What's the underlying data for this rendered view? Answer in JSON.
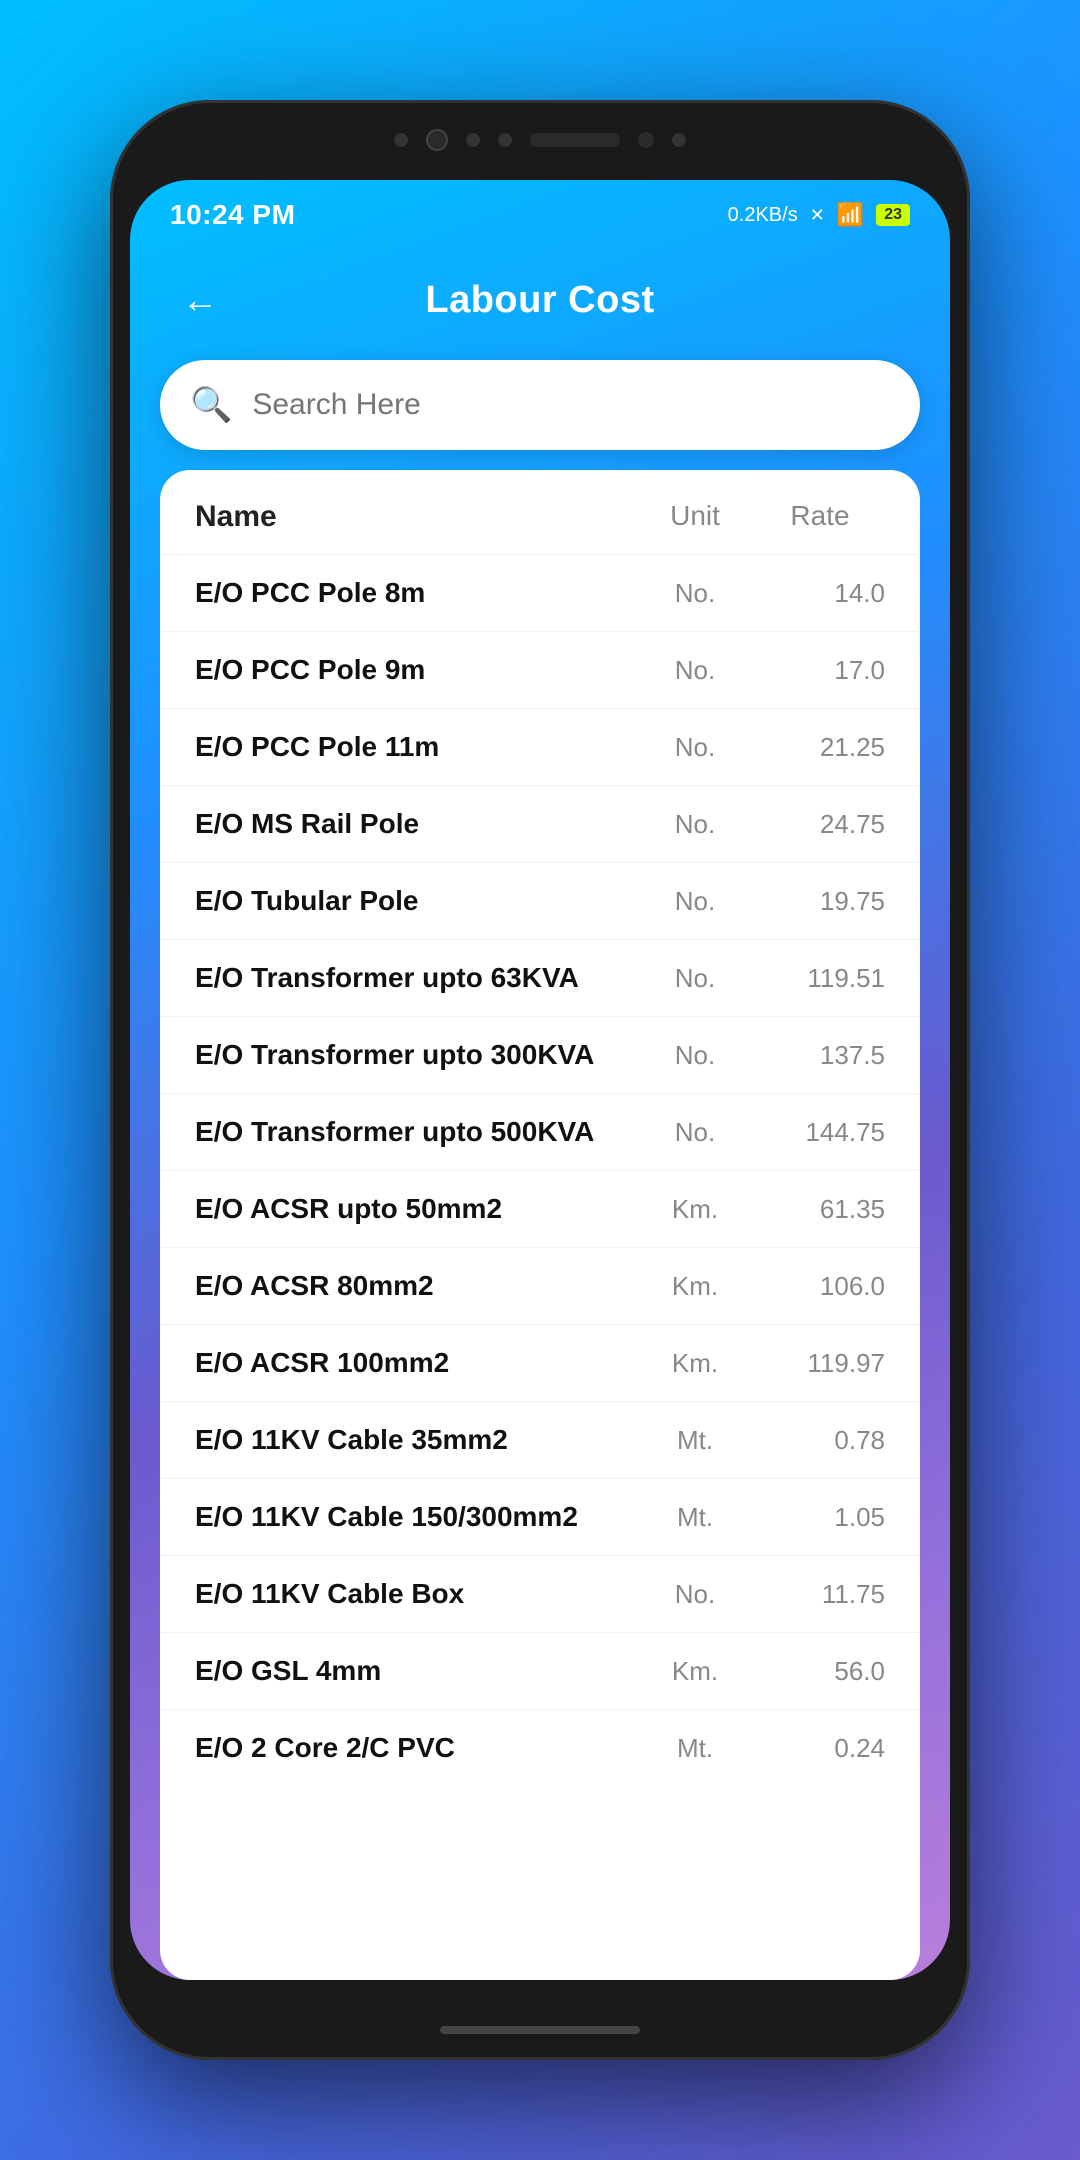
{
  "status": {
    "time": "10:24 PM",
    "speed": "0.2KB/s",
    "battery": "23"
  },
  "header": {
    "back_label": "←",
    "title": "Labour Cost"
  },
  "search": {
    "placeholder": "Search Here",
    "icon": "🔍"
  },
  "table": {
    "columns": {
      "name": "Name",
      "unit": "Unit",
      "rate": "Rate"
    },
    "rows": [
      {
        "name": "E/O PCC Pole 8m",
        "unit": "No.",
        "rate": "14.0"
      },
      {
        "name": "E/O PCC Pole 9m",
        "unit": "No.",
        "rate": "17.0"
      },
      {
        "name": "E/O PCC Pole 11m",
        "unit": "No.",
        "rate": "21.25"
      },
      {
        "name": "E/O MS Rail Pole",
        "unit": "No.",
        "rate": "24.75"
      },
      {
        "name": "E/O Tubular Pole",
        "unit": "No.",
        "rate": "19.75"
      },
      {
        "name": "E/O Transformer upto 63KVA",
        "unit": "No.",
        "rate": "119.51"
      },
      {
        "name": "E/O Transformer upto 300KVA",
        "unit": "No.",
        "rate": "137.5"
      },
      {
        "name": "E/O Transformer upto 500KVA",
        "unit": "No.",
        "rate": "144.75"
      },
      {
        "name": "E/O ACSR upto 50mm2",
        "unit": "Km.",
        "rate": "61.35"
      },
      {
        "name": "E/O ACSR 80mm2",
        "unit": "Km.",
        "rate": "106.0"
      },
      {
        "name": "E/O ACSR 100mm2",
        "unit": "Km.",
        "rate": "119.97"
      },
      {
        "name": "E/O 11KV Cable 35mm2",
        "unit": "Mt.",
        "rate": "0.78"
      },
      {
        "name": "E/O 11KV Cable 150/300mm2",
        "unit": "Mt.",
        "rate": "1.05"
      },
      {
        "name": "E/O 11KV Cable Box",
        "unit": "No.",
        "rate": "11.75"
      },
      {
        "name": "E/O GSL 4mm",
        "unit": "Km.",
        "rate": "56.0"
      },
      {
        "name": "E/O 2 Core 2/C PVC",
        "unit": "Mt.",
        "rate": "0.24"
      }
    ]
  }
}
